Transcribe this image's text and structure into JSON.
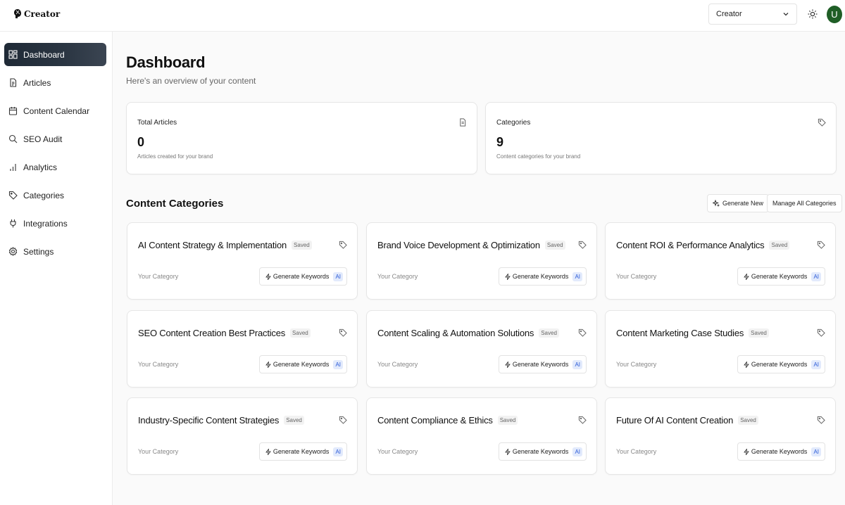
{
  "app": {
    "logo_text": "Creator"
  },
  "topbar": {
    "role_select_value": "Creator",
    "avatar_initial": "U"
  },
  "sidebar": {
    "items": [
      {
        "label": "Dashboard",
        "icon": "dashboard-icon"
      },
      {
        "label": "Articles",
        "icon": "file-text-icon"
      },
      {
        "label": "Content Calendar",
        "icon": "calendar-icon"
      },
      {
        "label": "SEO Audit",
        "icon": "search-icon"
      },
      {
        "label": "Analytics",
        "icon": "bar-chart-icon"
      },
      {
        "label": "Categories",
        "icon": "tag-icon"
      },
      {
        "label": "Integrations",
        "icon": "plug-icon"
      },
      {
        "label": "Settings",
        "icon": "gear-icon"
      }
    ]
  },
  "main": {
    "title": "Dashboard",
    "subtitle": "Here's an overview of your content",
    "stats": [
      {
        "label": "Total Articles",
        "value": "0",
        "desc": "Articles created for your brand",
        "icon": "file-text-icon"
      },
      {
        "label": "Categories",
        "value": "9",
        "desc": "Content categories for your brand",
        "icon": "tag-icon"
      }
    ],
    "section_title": "Content Categories",
    "generate_new_label": "Generate New",
    "manage_all_label": "Manage All Categories",
    "saved_badge": "Saved",
    "category_sub": "Your Category",
    "generate_keywords_label": "Generate Keywords",
    "ai_badge": "AI",
    "categories": [
      "AI Content Strategy & Implementation",
      "Brand Voice Development & Optimization",
      "Content ROI & Performance Analytics",
      "SEO Content Creation Best Practices",
      "Content Scaling & Automation Solutions",
      "Content Marketing Case Studies",
      "Industry-Specific Content Strategies",
      "Content Compliance & Ethics",
      "Future Of AI Content Creation"
    ]
  }
}
